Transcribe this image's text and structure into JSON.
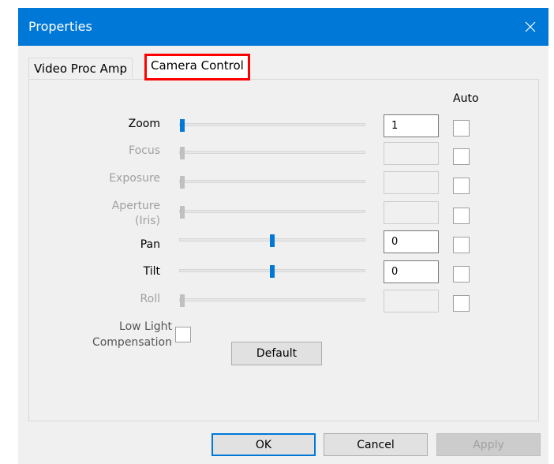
{
  "window": {
    "title": "Properties",
    "close_icon": "close-icon"
  },
  "tabs": [
    {
      "label": "Video Proc Amp",
      "active": false
    },
    {
      "label": "Camera Control",
      "active": true
    }
  ],
  "controls": {
    "auto_header": "Auto",
    "zoom": {
      "label": "Zoom",
      "value": "1",
      "enabled": true,
      "slider_level": 0.0,
      "auto": false
    },
    "focus": {
      "label": "Focus",
      "value": "",
      "enabled": false,
      "slider_level": 0.0,
      "auto": false
    },
    "exposure": {
      "label": "Exposure",
      "value": "",
      "enabled": false,
      "slider_level": 0.0,
      "auto": false
    },
    "aperture": {
      "label_line1": "Aperture",
      "label_line2": "(Iris)",
      "value": "",
      "enabled": false,
      "slider_level": 0.0,
      "auto": false
    },
    "pan": {
      "label": "Pan",
      "value": "0",
      "enabled": true,
      "slider_level": 0.5,
      "auto": false
    },
    "tilt": {
      "label": "Tilt",
      "value": "0",
      "enabled": true,
      "slider_level": 0.5,
      "auto": false
    },
    "roll": {
      "label": "Roll",
      "value": "",
      "enabled": false,
      "slider_level": 0.0,
      "auto": false
    },
    "low_light": {
      "label_line1": "Low Light",
      "label_line2": "Compensation",
      "checked": false
    },
    "default_button": "Default"
  },
  "buttons": {
    "ok": "OK",
    "cancel": "Cancel",
    "apply": "Apply"
  },
  "colors": {
    "titlebar": "#0078d7",
    "accent": "#0078d7",
    "highlight": "#ff0000"
  }
}
